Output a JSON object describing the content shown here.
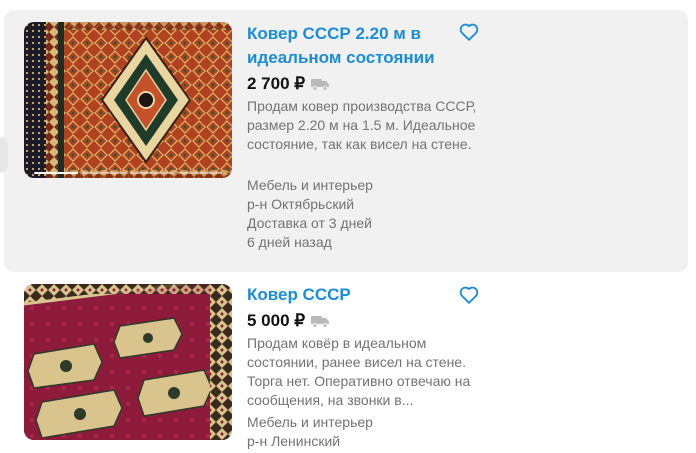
{
  "listings": [
    {
      "title": "Ковер СССР 2.20 м в идеальном состоянии",
      "price": "2 700 ₽",
      "description": "Продам ковер производства СССР, размер 2.20 м на 1.5 м. Идеальное состояние, так как висел на стене.",
      "category": "Мебель и интерьер",
      "district": "р-н Октябрьский",
      "delivery": "Доставка от 3 дней",
      "posted": "6 дней назад",
      "image_icon": "carpet-photo",
      "favorite_icon": "heart-icon",
      "delivery_icon": "truck-icon"
    },
    {
      "title": "Ковер СССР",
      "price": "5 000 ₽",
      "description": "Продам ковёр в идеальном состоянии, ранее висел на стене. Торга нет. Оперативно отвечаю на сообщения, на звонки в...",
      "category": "Мебель и интерьер",
      "district": "р-н Ленинский",
      "image_icon": "carpet-photo",
      "favorite_icon": "heart-icon",
      "delivery_icon": "truck-icon"
    }
  ],
  "colors": {
    "title_link": "#1a8cd8",
    "price": "#111111",
    "secondary_text": "#737373",
    "highlight_card": "#f1f1f1",
    "heart_outline": "#1a8cd8"
  }
}
